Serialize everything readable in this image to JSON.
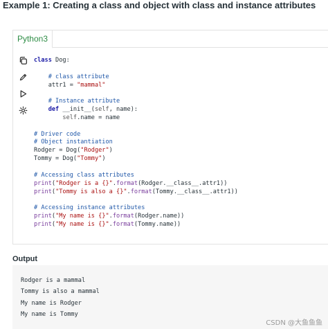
{
  "heading": "Example 1: Creating a class and object with class and instance attributes",
  "tab_label": "Python3",
  "toolbar": {
    "copy_icon": "copy-icon",
    "edit_icon": "pencil-icon",
    "run_icon": "play-icon",
    "settings_icon": "gear-icon"
  },
  "code_lines": [
    "class Dog:",
    "",
    "    # class attribute",
    "    attr1 = \"mammal\"",
    "",
    "    # Instance attribute",
    "    def __init__(self, name):",
    "        self.name = name",
    "",
    "# Driver code",
    "# Object instantiation",
    "Rodger = Dog(\"Rodger\")",
    "Tommy = Dog(\"Tommy\")",
    "",
    "# Accessing class attributes",
    "print(\"Rodger is a {}\".format(Rodger.__class__.attr1))",
    "print(\"Tommy is also a {}\".format(Tommy.__class__.attr1))",
    "",
    "# Accessing instance attributes",
    "print(\"My name is {}\".format(Rodger.name))",
    "print(\"My name is {}\".format(Tommy.name))"
  ],
  "output_title": "Output",
  "output_lines": [
    "Rodger is a mammal",
    "Tommy is also a mammal",
    "My name is Rodger",
    "My name is Tommy"
  ],
  "watermark": "CSDN @大鱼鱼鱼"
}
